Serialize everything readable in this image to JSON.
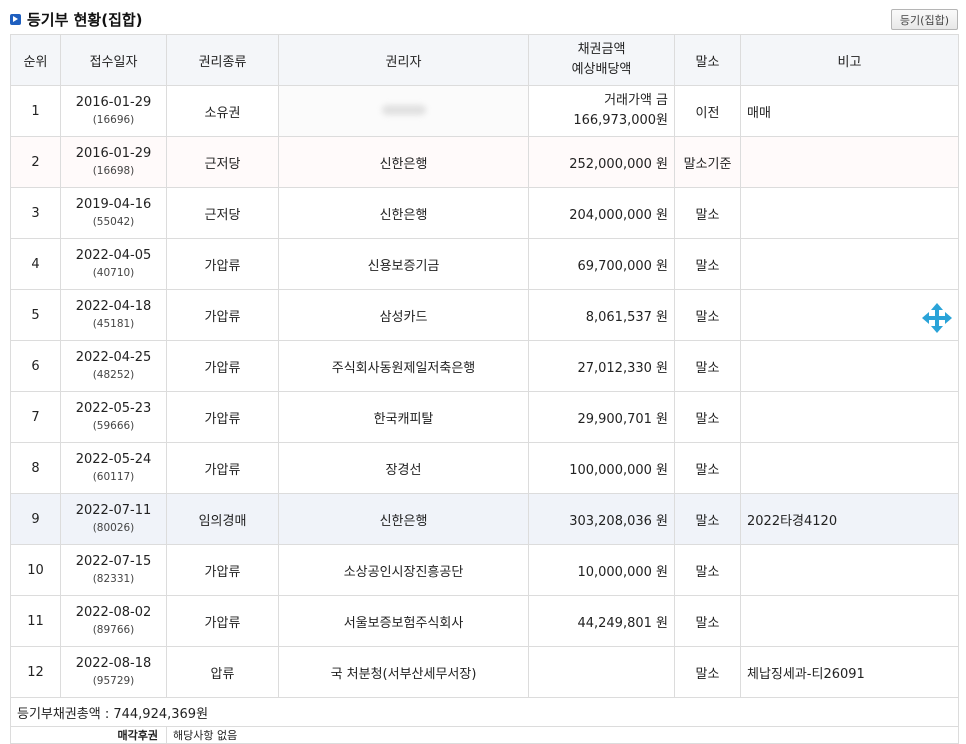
{
  "header": {
    "title": "등기부 현황(집합)",
    "button_label": "등기(집합)"
  },
  "table": {
    "columns": [
      "순위",
      "접수일자",
      "권리종류",
      "권리자",
      "채권금액",
      "예상배당액",
      "말소",
      "비고"
    ],
    "rows": [
      {
        "rank": "1",
        "date": "2016-01-29",
        "receipt": "(16696)",
        "type": "소유권",
        "holder": "",
        "amount_prefix": "거래가액 금",
        "amount": "166,973,000원",
        "cancel": "이전",
        "note": "매매"
      },
      {
        "rank": "2",
        "date": "2016-01-29",
        "receipt": "(16698)",
        "type": "근저당",
        "holder": "신한은행",
        "amount_prefix": "",
        "amount": "252,000,000 원",
        "cancel": "말소기준",
        "note": ""
      },
      {
        "rank": "3",
        "date": "2019-04-16",
        "receipt": "(55042)",
        "type": "근저당",
        "holder": "신한은행",
        "amount_prefix": "",
        "amount": "204,000,000 원",
        "cancel": "말소",
        "note": ""
      },
      {
        "rank": "4",
        "date": "2022-04-05",
        "receipt": "(40710)",
        "type": "가압류",
        "holder": "신용보증기금",
        "amount_prefix": "",
        "amount": "69,700,000 원",
        "cancel": "말소",
        "note": ""
      },
      {
        "rank": "5",
        "date": "2022-04-18",
        "receipt": "(45181)",
        "type": "가압류",
        "holder": "삼성카드",
        "amount_prefix": "",
        "amount": "8,061,537 원",
        "cancel": "말소",
        "note": ""
      },
      {
        "rank": "6",
        "date": "2022-04-25",
        "receipt": "(48252)",
        "type": "가압류",
        "holder": "주식회사동원제일저축은행",
        "amount_prefix": "",
        "amount": "27,012,330 원",
        "cancel": "말소",
        "note": ""
      },
      {
        "rank": "7",
        "date": "2022-05-23",
        "receipt": "(59666)",
        "type": "가압류",
        "holder": "한국캐피탈",
        "amount_prefix": "",
        "amount": "29,900,701 원",
        "cancel": "말소",
        "note": ""
      },
      {
        "rank": "8",
        "date": "2022-05-24",
        "receipt": "(60117)",
        "type": "가압류",
        "holder": "장경선",
        "amount_prefix": "",
        "amount": "100,000,000 원",
        "cancel": "말소",
        "note": ""
      },
      {
        "rank": "9",
        "date": "2022-07-11",
        "receipt": "(80026)",
        "type": "임의경매",
        "holder": "신한은행",
        "amount_prefix": "",
        "amount": "303,208,036 원",
        "cancel": "말소",
        "note": "2022타경4120"
      },
      {
        "rank": "10",
        "date": "2022-07-15",
        "receipt": "(82331)",
        "type": "가압류",
        "holder": "소상공인시장진흥공단",
        "amount_prefix": "",
        "amount": "10,000,000 원",
        "cancel": "말소",
        "note": ""
      },
      {
        "rank": "11",
        "date": "2022-08-02",
        "receipt": "(89766)",
        "type": "가압류",
        "holder": "서울보증보험주식회사",
        "amount_prefix": "",
        "amount": "44,249,801 원",
        "cancel": "말소",
        "note": ""
      },
      {
        "rank": "12",
        "date": "2022-08-18",
        "receipt": "(95729)",
        "type": "압류",
        "holder": "국 처분청(서부산세무서장)",
        "amount_prefix": "",
        "amount": "",
        "cancel": "말소",
        "note": "체납징세과-티26091"
      }
    ],
    "total_label": "등기부채권총액 : 744,924,369원",
    "bottom_label": "매각후권",
    "bottom_value": "해당사항 없음"
  },
  "icons": {
    "move": "move-arrows-icon",
    "accent": "#2aa3d8"
  }
}
